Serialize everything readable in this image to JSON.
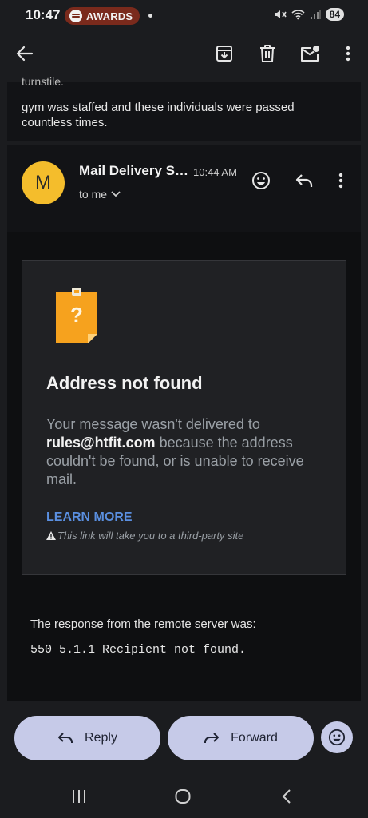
{
  "status_bar": {
    "time": "10:47",
    "notification_pill": "AWARDS",
    "battery": "84"
  },
  "icons": {
    "back": "arrow-left-icon",
    "archive": "archive-icon",
    "delete": "trash-icon",
    "unread": "mail-unread-icon",
    "more": "more-vert-icon"
  },
  "previous_message": {
    "cut_text": "turnstile.",
    "body": "gym was staffed and these individuals were passed countless times."
  },
  "message": {
    "avatar_letter": "M",
    "sender": "Mail Delivery S…",
    "time": "10:44 AM",
    "recipient": "to me"
  },
  "bounce": {
    "title": "Address not found",
    "desc_pre": "Your message wasn't delivered to ",
    "address": "rules@htfit.com",
    "desc_post": " because the address couldn't be found, or is unable to receive mail.",
    "learn_more": "LEARN MORE",
    "warning": "This link will take you to a third-party site",
    "response_label": "The response from the remote server was:",
    "response_code": "550 5.1.1 Recipient not found."
  },
  "actions": {
    "reply": "Reply",
    "forward": "Forward"
  },
  "colors": {
    "background": "#1b1c1f",
    "card": "#121316",
    "avatar": "#f4bd2c",
    "link": "#5a8fe0",
    "button": "#c6cae8"
  }
}
